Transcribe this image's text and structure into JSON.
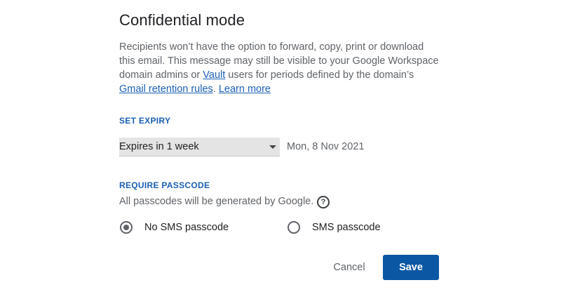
{
  "dialog": {
    "title": "Confidential mode",
    "description": {
      "part1": "Recipients won’t have the option to forward, copy, print or download this email. This message may still be visible to your Google Workspace domain admins or ",
      "vault_link": "Vault",
      "part2": " users for periods defined by the domain’s ",
      "retention_link": "Gmail retention rules",
      "part3": ". ",
      "learn_more_link": "Learn more"
    },
    "expiry": {
      "label": "SET EXPIRY",
      "selected": "Expires in 1 week",
      "date": "Mon, 8 Nov 2021"
    },
    "passcode": {
      "label": "REQUIRE PASSCODE",
      "note": "All passcodes will be generated by Google.",
      "help_glyph": "?",
      "options": [
        {
          "label": "No SMS passcode",
          "checked": true
        },
        {
          "label": "SMS passcode",
          "checked": false
        }
      ]
    },
    "actions": {
      "cancel_label": "Cancel",
      "save_label": "Save"
    }
  },
  "colors": {
    "link": "#1a5fb4",
    "primary_button": "#0b57a4",
    "select_bg": "#e4e4e4"
  }
}
